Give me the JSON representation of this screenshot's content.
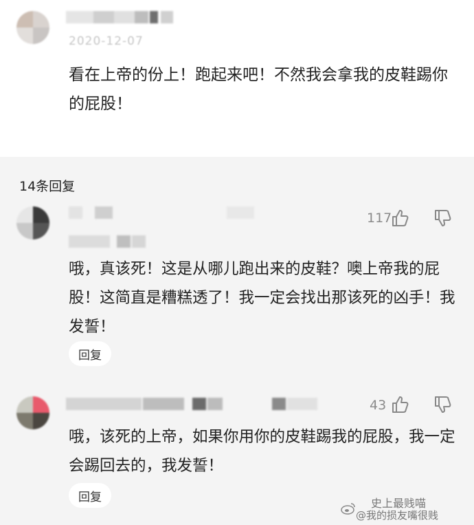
{
  "comment": {
    "date": "2020-12-07",
    "text": "看在上帝的份上！跑起来吧！不然我会拿我的皮鞋踢你的屁股！"
  },
  "replies_header": "14条回复",
  "replies": [
    {
      "likes": "117",
      "text": "哦，真该死！这是从哪儿跑出来的皮鞋？噢上帝我的屁股！这简直是糟糕透了！我一定会找出那该死的凶手！我发誓！",
      "reply_label": "回复"
    },
    {
      "likes": "43",
      "text": "哦，该死的上帝，如果你用你的皮鞋踢我的屁股，我一定会踢回去的，我发誓！",
      "reply_label": "回复"
    }
  ],
  "watermark": {
    "line1": "史上最贱喵",
    "line2": "@我的损友嘴很贱"
  },
  "icons": [
    "thumbs-up-icon",
    "thumbs-down-icon",
    "weibo-logo-icon"
  ]
}
